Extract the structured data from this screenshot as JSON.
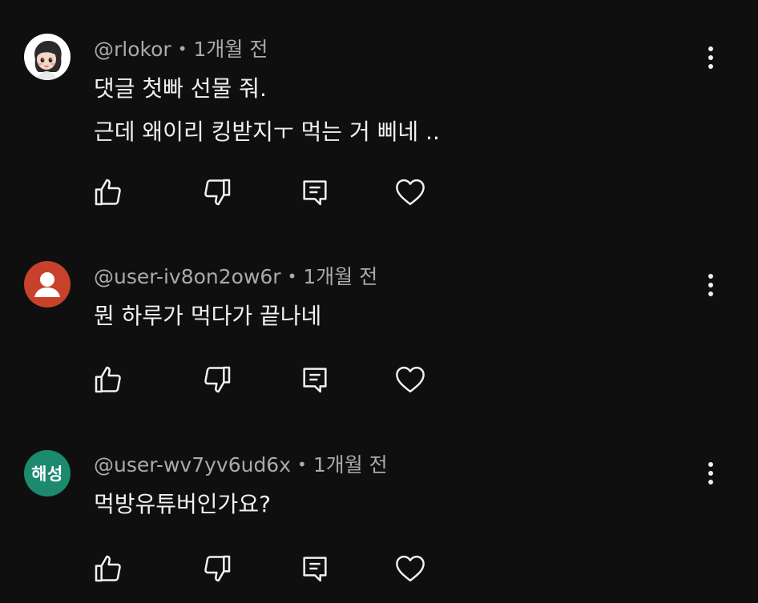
{
  "comments": [
    {
      "username": "@rlokor",
      "separator": "•",
      "time": "1개월 전",
      "avatar_type": "photo",
      "lines": [
        "댓글 첫빠 선물 줘.",
        "근데 왜이리 킹받지ㅜ 먹는 거 삐네 .."
      ]
    },
    {
      "username": "@user-iv8on2ow6r",
      "separator": "•",
      "time": "1개월 전",
      "avatar_type": "default-person",
      "avatar_color": "#c8412a",
      "lines": [
        "뭔 하루가 먹다가 끝나네"
      ]
    },
    {
      "username": "@user-wv7yv6ud6x",
      "separator": "•",
      "time": "1개월 전",
      "avatar_type": "text",
      "avatar_text": "해성",
      "avatar_color": "#1b8a6f",
      "lines": [
        "먹방유튜버인가요?"
      ]
    }
  ],
  "actions": {
    "like_icon": "thumbs-up-icon",
    "dislike_icon": "thumbs-down-icon",
    "reply_icon": "reply-icon",
    "heart_icon": "heart-icon",
    "more_icon": "more-vertical-icon"
  },
  "colors": {
    "background": "#0f0f0f",
    "text": "#f1f1f1",
    "meta": "#aaaaaa"
  }
}
